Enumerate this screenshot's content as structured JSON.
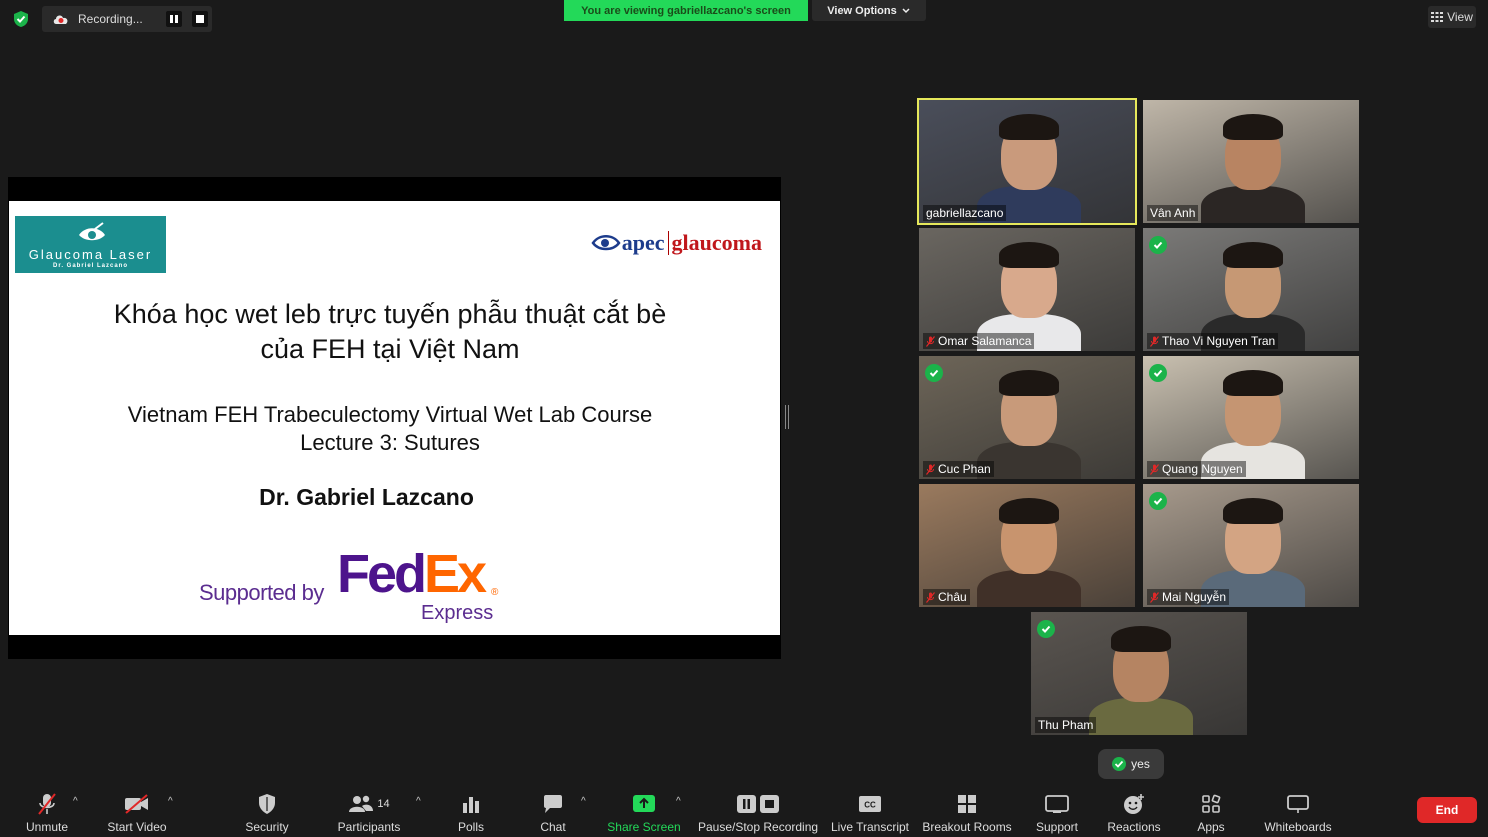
{
  "topbar": {
    "recording_label": "Recording...",
    "viewing_banner": "You are viewing gabriellazcano's screen",
    "view_options_label": "View Options",
    "view_label": "View"
  },
  "slide": {
    "logo_left_line1": "Glaucoma Laser",
    "logo_left_line2": "Dr. Gabriel Lazcano",
    "logo_right_part1": "apec",
    "logo_right_part2": "glaucoma",
    "title_line1": "Khóa học wet leb trực tuyến phẫu thuật cắt bè",
    "title_line2": "của FEH  tại Việt Nam",
    "subtitle_line1": "Vietnam FEH Trabeculectomy Virtual Wet Lab Course",
    "subtitle_line2": "Lecture 3: Sutures",
    "author": "Dr.  Gabriel Lazcano",
    "supported_by": "Supported by",
    "sponsor_part1": "Fed",
    "sponsor_part2": "Ex",
    "sponsor_sub": "Express",
    "registered_mark": "®"
  },
  "participants": [
    {
      "name": "gabriellazcano",
      "muted": false,
      "check": false,
      "active": true,
      "bg": "#4a4e5a",
      "skin": "#c99a7c",
      "shirt": "#2f3b5c"
    },
    {
      "name": "Vân Anh",
      "muted": false,
      "check": false,
      "active": false,
      "bg": "#bfb6a8",
      "skin": "#b88462",
      "shirt": "#2b2624"
    },
    {
      "name": "Omar Salamanca",
      "muted": true,
      "check": false,
      "active": false,
      "bg": "#6a6660",
      "skin": "#d8a98c",
      "shirt": "#e8e8ea"
    },
    {
      "name": "Thao Vi Nguyen Tran",
      "muted": true,
      "check": true,
      "active": false,
      "bg": "#7b7a78",
      "skin": "#c69874",
      "shirt": "#2a2a2a"
    },
    {
      "name": "Cuc Phan",
      "muted": true,
      "check": true,
      "active": false,
      "bg": "#6d6558",
      "skin": "#c89a7a",
      "shirt": "#3a3530"
    },
    {
      "name": "Quang Nguyen",
      "muted": true,
      "check": true,
      "active": false,
      "bg": "#c9c0b0",
      "skin": "#c59572",
      "shirt": "#e6e4e0"
    },
    {
      "name": "Châu",
      "muted": true,
      "check": false,
      "active": false,
      "bg": "#9a7a5e",
      "skin": "#c8946e",
      "shirt": "#403028"
    },
    {
      "name": "Mai Nguyễn",
      "muted": true,
      "check": true,
      "active": false,
      "bg": "#a79a8c",
      "skin": "#d3a483",
      "shirt": "#5a6a7a"
    },
    {
      "name": "Thu Pham",
      "muted": false,
      "check": true,
      "active": false,
      "bg": "#5a5550",
      "skin": "#b58462",
      "shirt": "#6a6a40"
    }
  ],
  "reaction": {
    "label": "yes"
  },
  "toolbar": {
    "unmute": "Unmute",
    "start_video": "Start Video",
    "security": "Security",
    "participants": "Participants",
    "participants_count": "14",
    "polls": "Polls",
    "chat": "Chat",
    "share_screen": "Share Screen",
    "pause_stop_recording": "Pause/Stop Recording",
    "live_transcript": "Live Transcript",
    "breakout_rooms": "Breakout Rooms",
    "support": "Support",
    "reactions": "Reactions",
    "apps": "Apps",
    "whiteboards": "Whiteboards",
    "end": "End"
  },
  "colors": {
    "share_banner": "#23d959",
    "end_button": "#e02828",
    "active_speaker": "#e6e85b",
    "check": "#1bb34a"
  }
}
